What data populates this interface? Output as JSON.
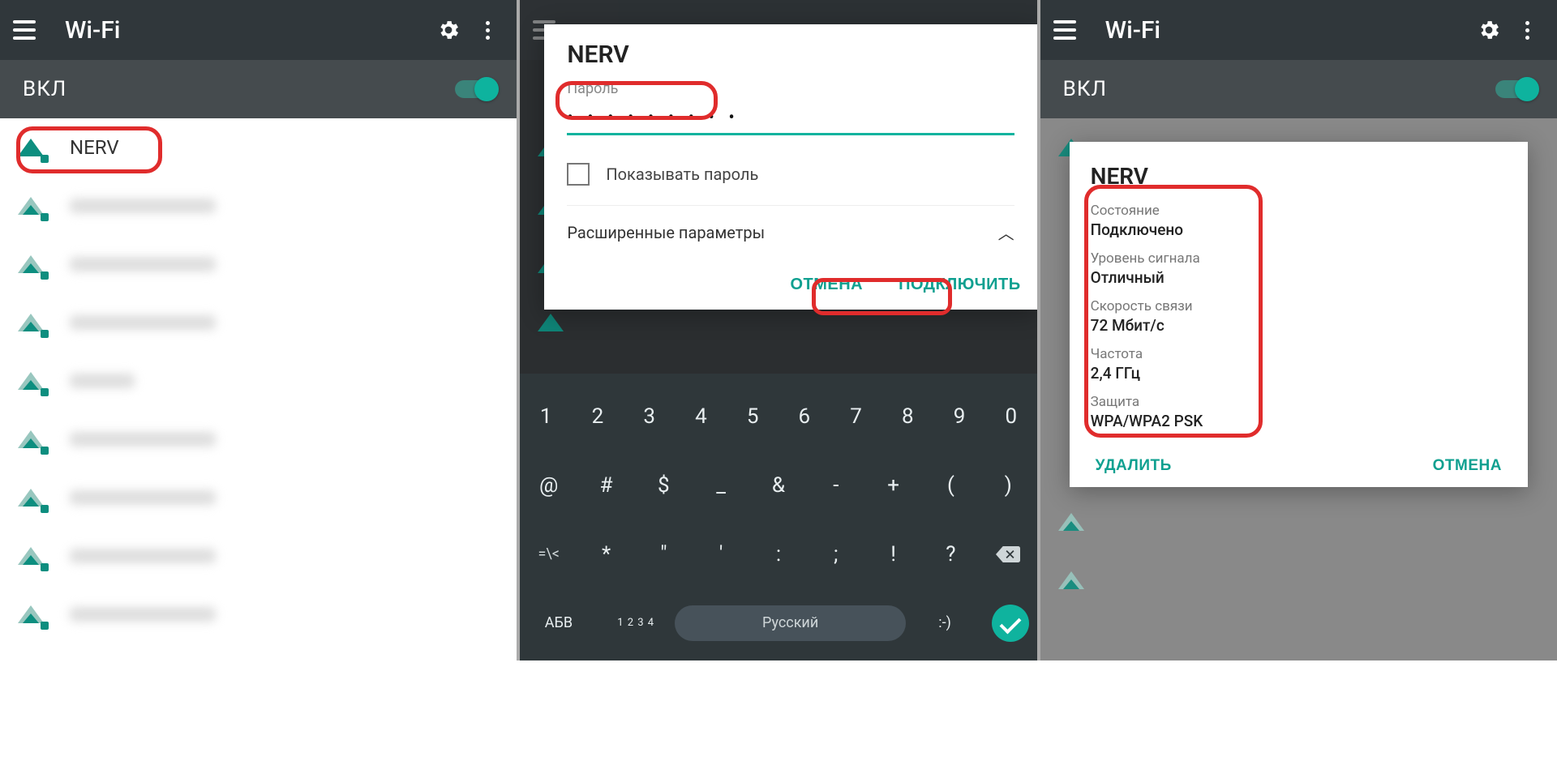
{
  "panel1": {
    "appbar_title": "Wi-Fi",
    "toggle_label": "ВКЛ",
    "networks": [
      "NERV"
    ]
  },
  "panel2": {
    "dialog": {
      "ssid": "NERV",
      "password_label": "Пароль",
      "password_mask": "• • • • • • • • •",
      "show_password": "Показывать пароль",
      "advanced": "Расширенные параметры",
      "cancel": "ОТМЕНА",
      "connect": "ПОДКЛЮЧИТЬ"
    },
    "keyboard": {
      "row1": [
        "1",
        "2",
        "3",
        "4",
        "5",
        "6",
        "7",
        "8",
        "9",
        "0"
      ],
      "row2": [
        "@",
        "#",
        "$",
        "_",
        "&",
        "-",
        "+",
        "(",
        ")"
      ],
      "row3_lead": "=\\<",
      "row3": [
        "*",
        "\"",
        "'",
        ":",
        ";",
        "!",
        "?"
      ],
      "abc": "АБВ",
      "sub12": "1 2\n3 4",
      "space": "Русский",
      "emoji": ":-)"
    }
  },
  "panel3": {
    "appbar_title": "Wi-Fi",
    "toggle_label": "ВКЛ",
    "dialog": {
      "ssid": "NERV",
      "status_label": "Состояние",
      "status_value": "Подключено",
      "signal_label": "Уровень сигнала",
      "signal_value": "Отличный",
      "speed_label": "Скорость связи",
      "speed_value": "72 Мбит/с",
      "freq_label": "Частота",
      "freq_value": "2,4 ГГц",
      "security_label": "Защита",
      "security_value": "WPA/WPA2 PSK",
      "forget": "УДАЛИТЬ",
      "cancel": "ОТМЕНА"
    }
  }
}
